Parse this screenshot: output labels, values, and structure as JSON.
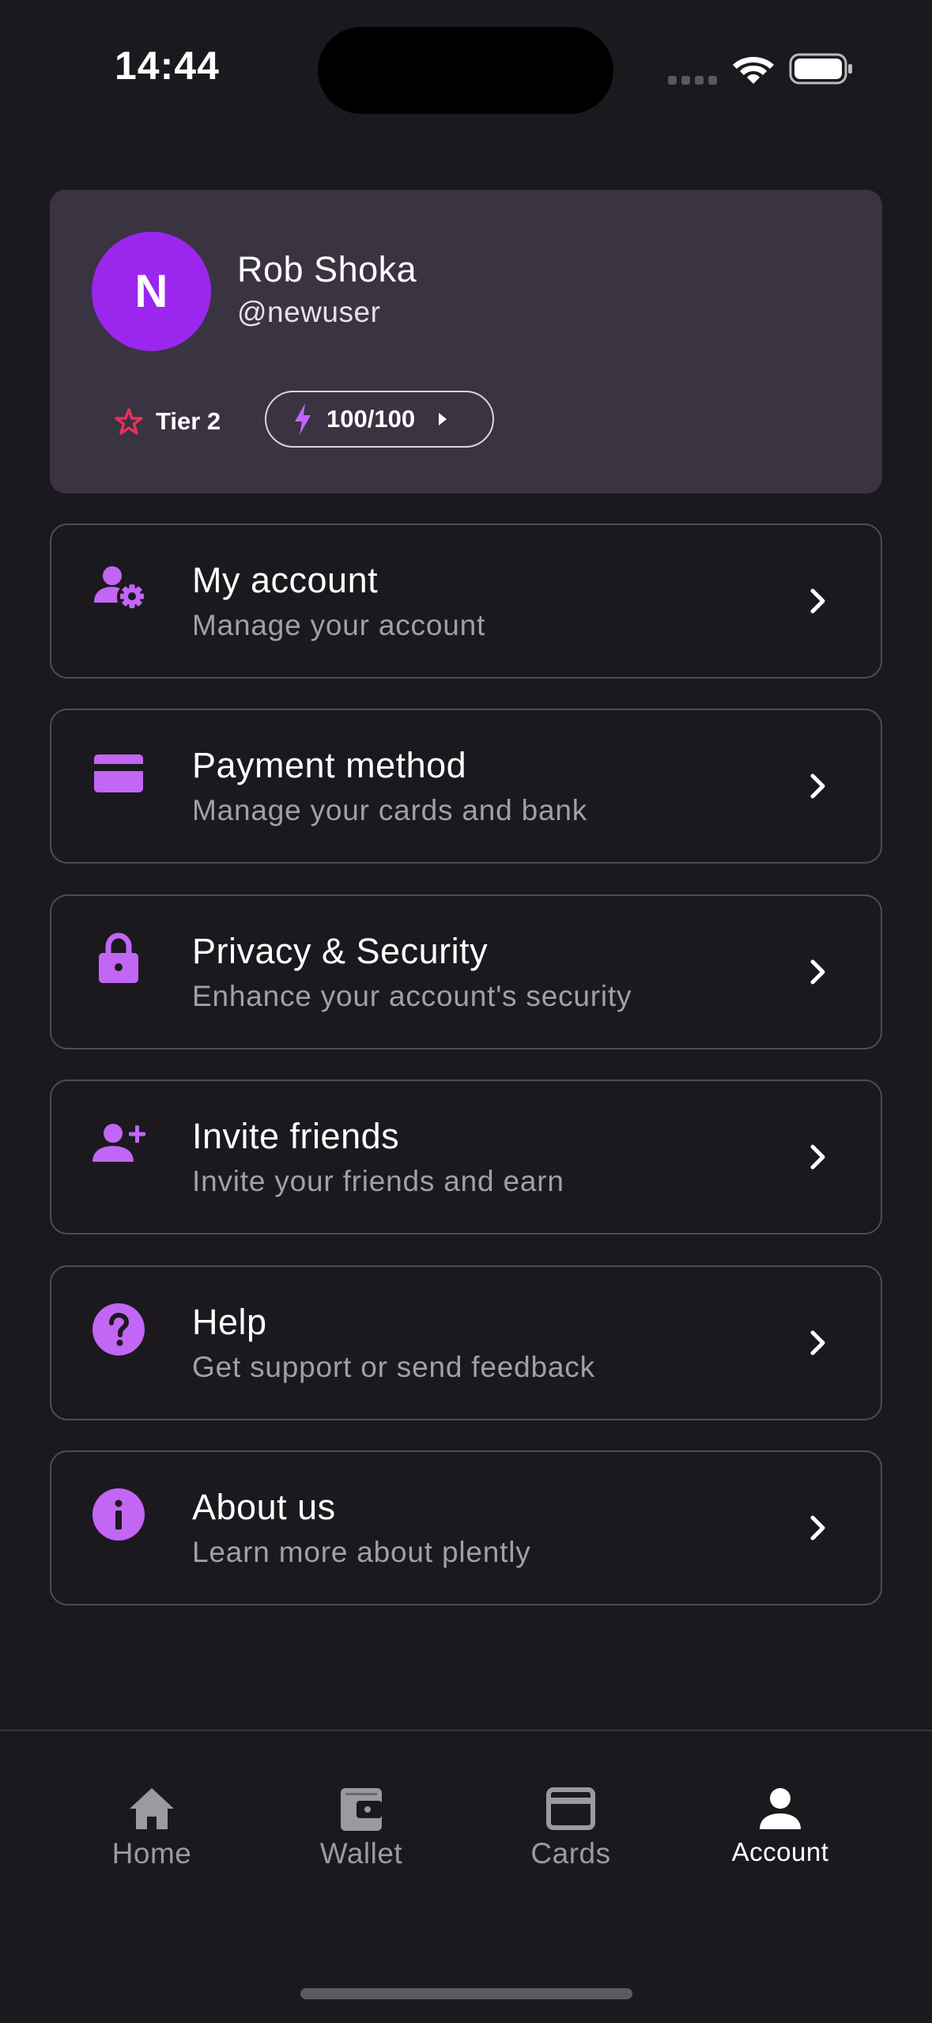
{
  "status_bar": {
    "time": "14:44"
  },
  "profile": {
    "avatar_initial": "N",
    "name": "Rob Shoka",
    "handle": "@newuser",
    "tier": "Tier 2",
    "energy": "100/100"
  },
  "menu": [
    {
      "icon": "user-gear-icon",
      "title": "My account",
      "subtitle": "Manage your account"
    },
    {
      "icon": "credit-card-icon",
      "title": "Payment method",
      "subtitle": "Manage your cards and bank"
    },
    {
      "icon": "lock-icon",
      "title": "Privacy & Security",
      "subtitle": "Enhance your account's security"
    },
    {
      "icon": "user-plus-icon",
      "title": "Invite friends",
      "subtitle": "Invite your friends and earn"
    },
    {
      "icon": "help-circle-icon",
      "title": "Help",
      "subtitle": "Get support or send feedback"
    },
    {
      "icon": "info-circle-icon",
      "title": "About us",
      "subtitle": "Learn more about plently"
    }
  ],
  "bottom_nav": {
    "items": [
      {
        "label": "Home",
        "icon": "home-icon"
      },
      {
        "label": "Wallet",
        "icon": "wallet-icon"
      },
      {
        "label": "Cards",
        "icon": "card-icon"
      },
      {
        "label": "Account",
        "icon": "person-icon"
      }
    ],
    "active": "Account"
  },
  "colors": {
    "background": "#1b191e",
    "card": "#3a3342",
    "accent": "#c266f5",
    "avatar": "#9b27ee",
    "star": "#e8305c",
    "muted_text": "#a29fa6"
  }
}
